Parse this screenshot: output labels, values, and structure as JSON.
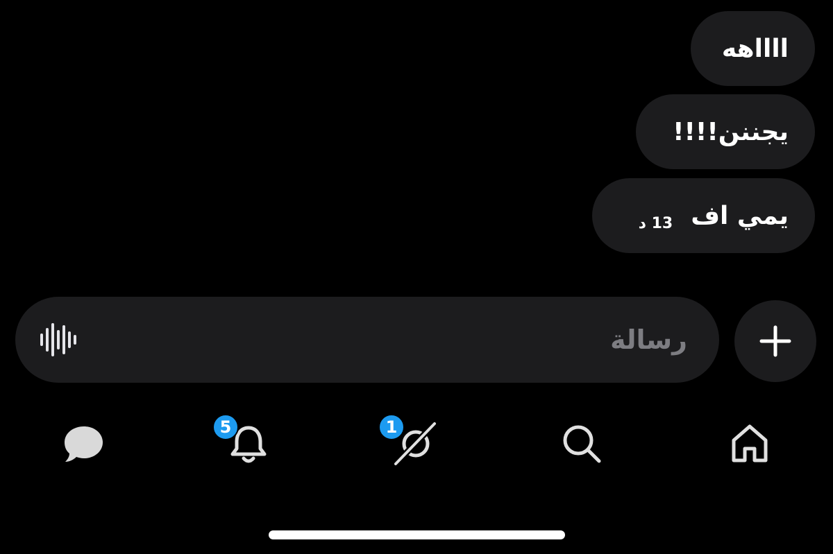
{
  "messages": [
    {
      "text": "ااااهه",
      "time": ""
    },
    {
      "text": "يجننن!!!!",
      "time": ""
    },
    {
      "text": "يمي اف",
      "time": "13 د"
    }
  ],
  "composer": {
    "placeholder": "رسالة",
    "voice_icon": "waveform-icon",
    "add_icon": "plus-icon"
  },
  "tab_bar": {
    "items": [
      {
        "name": "messages",
        "icon": "chat-bubble-icon"
      },
      {
        "name": "notifications",
        "icon": "bell-icon",
        "badge": "5"
      },
      {
        "name": "spaces",
        "icon": "grok-icon",
        "badge": "1"
      },
      {
        "name": "search",
        "icon": "search-icon"
      },
      {
        "name": "home",
        "icon": "home-icon"
      }
    ]
  },
  "colors": {
    "background": "#000000",
    "bubble": "#1c1c1e",
    "badge": "#1d9bf0",
    "placeholder": "#7d7d82"
  }
}
